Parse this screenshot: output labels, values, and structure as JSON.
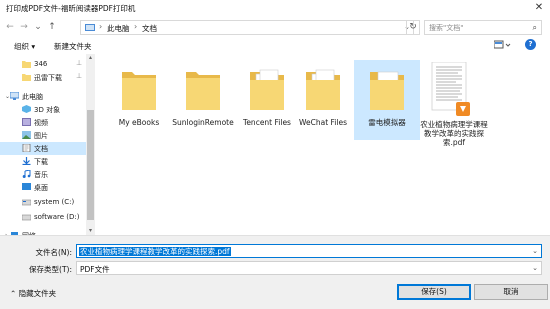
{
  "window": {
    "title": "打印成PDF文件-福昕阅读器PDF打印机",
    "close_glyph": "✕"
  },
  "nav": {
    "back_glyph": "←",
    "forward_glyph": "→",
    "down_glyph": "⌄",
    "up_glyph": "↑",
    "breadcrumbs": [
      "此电脑",
      "文档"
    ],
    "separator": "›",
    "refresh_glyph": "↻"
  },
  "search": {
    "placeholder": "搜索\"文档\""
  },
  "toolbar": {
    "organize_label": "组织 ▾",
    "new_folder_label": "新建文件夹",
    "help_label": "?"
  },
  "sidebar": {
    "items": [
      {
        "label": "346",
        "icon": "folder-icon",
        "pinned": true
      },
      {
        "label": "迅雷下载",
        "icon": "folder-icon",
        "pinned": true
      },
      {
        "label": "此电脑",
        "icon": "computer-icon"
      },
      {
        "label": "3D 对象",
        "icon": "3d-objects-icon"
      },
      {
        "label": "视频",
        "icon": "video-icon"
      },
      {
        "label": "图片",
        "icon": "pictures-icon"
      },
      {
        "label": "文档",
        "icon": "documents-icon",
        "selected": true
      },
      {
        "label": "下载",
        "icon": "download-icon"
      },
      {
        "label": "音乐",
        "icon": "music-icon"
      },
      {
        "label": "桌面",
        "icon": "desktop-icon"
      },
      {
        "label": "system (C:)",
        "icon": "drive-icon"
      },
      {
        "label": "software (D:)",
        "icon": "drive-icon"
      },
      {
        "label": "网络",
        "icon": "network-icon"
      }
    ],
    "pin_glyph": "📌"
  },
  "files": [
    {
      "name": "My eBooks",
      "type": "folder"
    },
    {
      "name": "SunloginRemote",
      "type": "folder"
    },
    {
      "name": "Tencent Files",
      "type": "folder"
    },
    {
      "name": "WeChat Files",
      "type": "folder"
    },
    {
      "name": "雷电模拟器",
      "type": "folder",
      "selected": true
    },
    {
      "name": "农业植物病理学课程教学改革的实践探索.pdf",
      "type": "pdf"
    }
  ],
  "bottom": {
    "filename_label": "文件名(N):",
    "filename_value": "农业植物病理学课程教学改革的实践探索.pdf",
    "filetype_label": "保存类型(T):",
    "filetype_value": "PDF文件",
    "hide_folders_label": "隐藏文件夹",
    "save_label": "保存(S)",
    "cancel_label": "取消"
  },
  "colors": {
    "accent": "#0078d7",
    "selection": "#cce8ff",
    "folder": "#f7d774"
  }
}
